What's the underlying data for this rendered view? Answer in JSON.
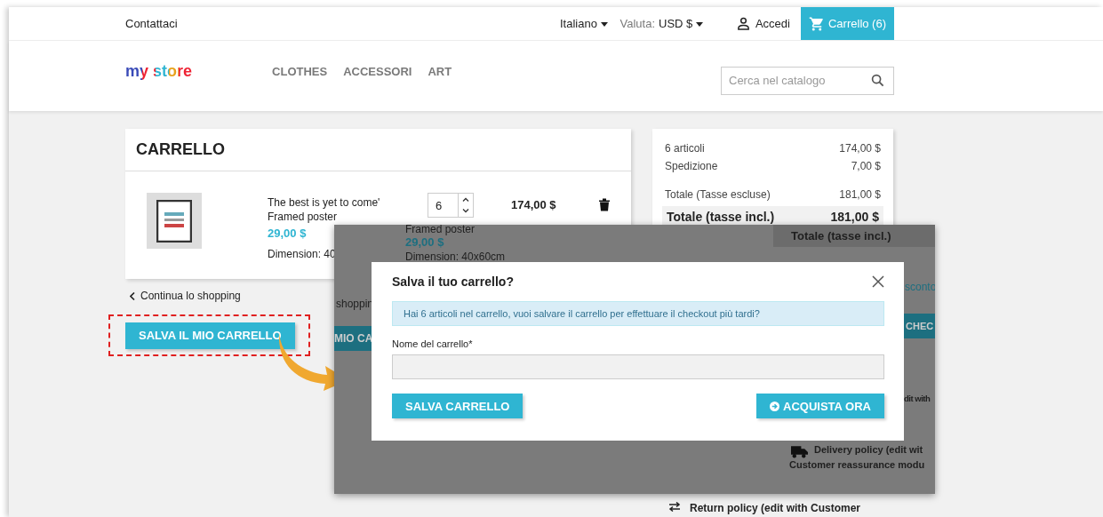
{
  "top_bar": {
    "contact": "Contattaci",
    "language": "Italiano",
    "currency_label": "Valuta:",
    "currency": "USD $",
    "login": "Accedi",
    "cart_button": "Carrello (6)"
  },
  "header": {
    "logo": "my store",
    "nav": [
      "CLOTHES",
      "ACCESSORI",
      "ART"
    ],
    "search": {
      "placeholder": "Cerca nel catalogo"
    }
  },
  "cart": {
    "title": "CARRELLO",
    "items": [
      {
        "name": "The best is yet to come' Framed poster",
        "price": "29,00 $",
        "attribute": "Dimension: 40",
        "quantity": "6",
        "total": "174,00 $"
      }
    ],
    "continue_link": "Continua lo shopping",
    "save_button": "SALVA IL MIO CARRELLO"
  },
  "summary": {
    "rows": [
      {
        "kind": "line",
        "label": "6 articoli",
        "value": "174,00 $"
      },
      {
        "kind": "line",
        "label": "Spedizione",
        "value": "7,00 $"
      },
      {
        "kind": "subtotal",
        "label": "Totale (Tasse escluse)",
        "value": "181,00 $"
      },
      {
        "kind": "total",
        "label": "Totale (tasse incl.)",
        "value": "181,00 $"
      }
    ]
  },
  "reassurance": {
    "return_policy": "Return policy (edit with Customer"
  },
  "inset": {
    "product_name": "Framed poster",
    "price": "29,00 $",
    "attribute": "Dimension: 40x60cm",
    "continue_link": "shoppin",
    "save_button": "MIO CA",
    "total_incl": "Totale (tasse incl.)",
    "discount_link": "sconto",
    "checkout_button": "CHEC",
    "reassurance_1": "dit with",
    "delivery_line1": "Delivery policy (edit wit",
    "delivery_line2": "Customer reassurance modu",
    "modal": {
      "title": "Salva il tuo carrello?",
      "message": "Hai 6 articoli nel carrello, vuoi salvare il carrello per effettuare il checkout più tardi?",
      "field_label": "Nome del carrello*",
      "save_button": "SALVA CARRELLO",
      "buy_button": "ACQUISTA ORA"
    }
  }
}
